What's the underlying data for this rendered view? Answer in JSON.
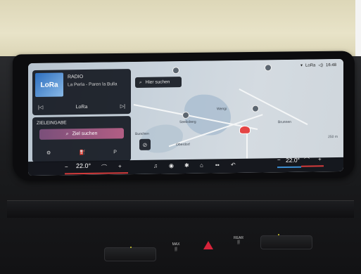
{
  "status": {
    "network": "LoRa",
    "time": "16:48"
  },
  "media": {
    "kind": "RADIO",
    "title": "La Perla - Paren la Bulla",
    "station": "LoRa",
    "cover": "LoRa",
    "prev_icon": "skip-back-icon",
    "next_icon": "skip-forward-icon"
  },
  "destination": {
    "title": "ZIELEINGABE",
    "search_label": "Ziel suchen",
    "parking": "P"
  },
  "map": {
    "search_label": "Hier suchen",
    "scale": "250 m",
    "places": [
      "Buochen",
      "Wengi",
      "Oberdorf",
      "Seelisberg",
      "Brunnen"
    ]
  },
  "climate": {
    "left_temp": "22.0°",
    "right_temp": "22.0°",
    "minus": "−",
    "plus": "+"
  },
  "physical": {
    "max_label": "MAX",
    "rear_label": "REAR"
  }
}
